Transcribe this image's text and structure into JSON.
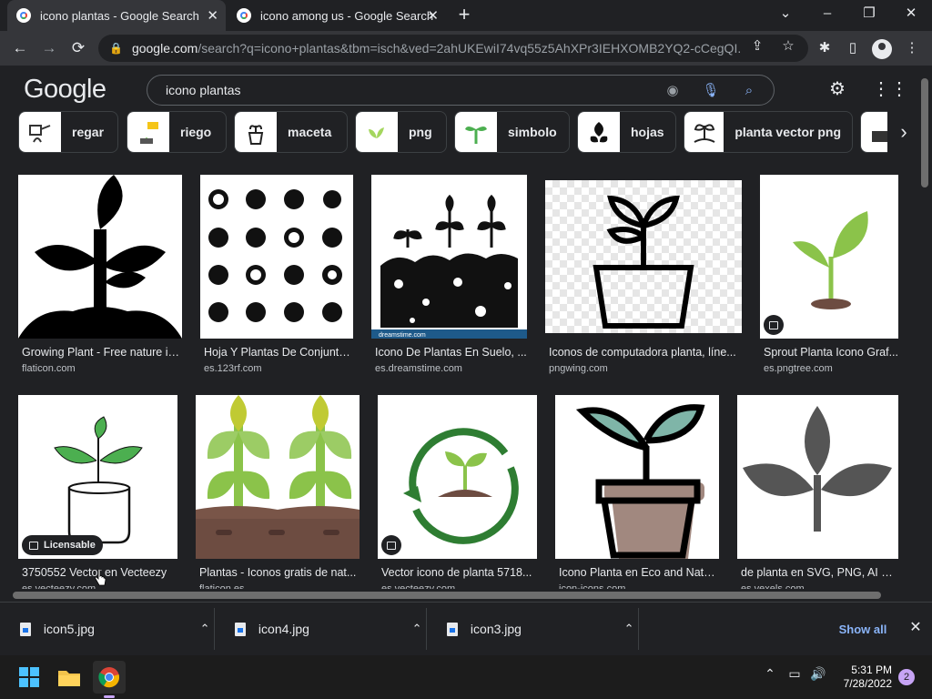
{
  "browser": {
    "tabs": [
      {
        "title": "icono plantas - Google Search",
        "active": true
      },
      {
        "title": "icono among us - Google Search",
        "active": false
      }
    ],
    "new_tab": "+",
    "window_controls": {
      "minimize": "–",
      "restore": "❐",
      "close": "✕",
      "menu": "⌄"
    },
    "address": {
      "domain": "google.com",
      "path": "/search?q=icono+plantas&tbm=isch&ved=2ahUKEwiI74vq55z5AhXPr3IEHXOMB2YQ2-cCegQI..."
    },
    "nav": {
      "back": "←",
      "forward": "→",
      "reload": "⟳"
    }
  },
  "google": {
    "logo": "Google",
    "query": "icono plantas",
    "chips": [
      "regar",
      "riego",
      "maceta",
      "png",
      "simbolo",
      "hojas",
      "planta vector png"
    ]
  },
  "results": [
    {
      "title": "Growing Plant - Free nature ic...",
      "source": "flaticon.com",
      "badge": ""
    },
    {
      "title": "Hoja Y Plantas De Conjunto...",
      "source": "es.123rf.com",
      "badge": ""
    },
    {
      "title": "Icono De Plantas En Suelo, ...",
      "source": "es.dreamstime.com",
      "badge": ""
    },
    {
      "title": "Iconos de computadora planta, líne...",
      "source": "pngwing.com",
      "badge": ""
    },
    {
      "title": "Sprout Planta Icono Graf...",
      "source": "es.pngtree.com",
      "badge": "image"
    },
    {
      "title": "3750552 Vector en Vecteezy",
      "source": "es.vecteezy.com",
      "badge": "Licensable"
    },
    {
      "title": "Plantas - Iconos gratis de nat...",
      "source": "flaticon.es",
      "badge": ""
    },
    {
      "title": "Vector icono de planta 5718...",
      "source": "es.vecteezy.com",
      "badge": "image"
    },
    {
      "title": "Icono Planta en Eco and Natu...",
      "source": "icon-icons.com",
      "badge": ""
    },
    {
      "title": "de planta en SVG, PNG, AI pa...",
      "source": "es.vexels.com",
      "badge": ""
    }
  ],
  "image_captions": {
    "dreamstime": "dreamstime.com"
  },
  "downloads": {
    "items": [
      "icon5.jpg",
      "icon4.jpg",
      "icon3.jpg"
    ],
    "show_all": "Show all",
    "close": "✕"
  },
  "taskbar": {
    "time": "5:31 PM",
    "date": "7/28/2022",
    "notifications": "2"
  },
  "colors": {
    "bg": "#202124",
    "accent": "#8ab4f8",
    "plant_green": "#8bc34a",
    "dark_plant": "#555555"
  }
}
